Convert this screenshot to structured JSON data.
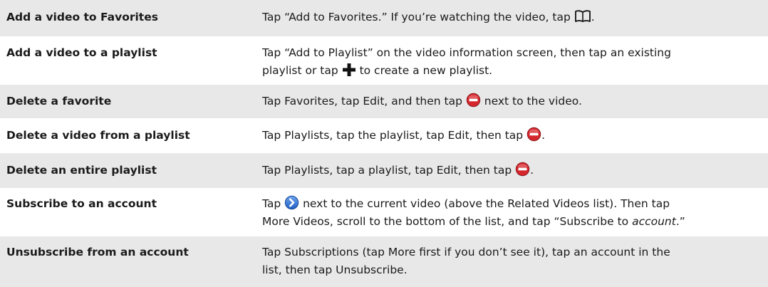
{
  "rows": [
    {
      "task": "Add a video to Favorites",
      "instruction": {
        "before_icon": "Tap “Add to Favorites.” If you’re watching the video, tap ",
        "icon": "bookmarks-icon",
        "after_icon": "."
      }
    },
    {
      "task": "Add a video to a playlist",
      "instruction": {
        "line1": "Tap “Add to Playlist” on the video information screen, then tap an existing",
        "before_icon": "playlist or tap ",
        "icon": "plus-icon",
        "after_icon": " to create a new playlist."
      }
    },
    {
      "task": "Delete a favorite",
      "instruction": {
        "before_icon": "Tap Favorites, tap Edit, and then tap ",
        "icon": "delete-icon",
        "after_icon": " next to the video."
      }
    },
    {
      "task": "Delete a video from a playlist",
      "instruction": {
        "before_icon": "Tap Playlists, tap the playlist, tap Edit, then tap ",
        "icon": "delete-icon",
        "after_icon": "."
      }
    },
    {
      "task": "Delete an entire playlist",
      "instruction": {
        "before_icon": "Tap Playlists, tap a playlist, tap Edit, then tap ",
        "icon": "delete-icon",
        "after_icon": "."
      }
    },
    {
      "task": "Subscribe to an account",
      "instruction": {
        "before_icon": "Tap ",
        "icon": "detail-disclosure-icon",
        "after_icon": " next to the current video (above the Related Videos list). Then tap",
        "line2_before": "More Videos, scroll to the bottom of the list, and tap “Subscribe to ",
        "line2_italic": "account",
        "line2_after": ".”"
      }
    },
    {
      "task": "Unsubscribe from an account",
      "instruction": {
        "line1": "Tap Subscriptions (tap More first if you don’t see it), tap an account in the",
        "line2": "list, then tap Unsubscribe."
      }
    }
  ],
  "colors": {
    "row_grey": "#e8e8e9",
    "row_white": "#ffffff",
    "delete_red": "#d6262d",
    "disclosure_blue": "#3a7bd5"
  }
}
